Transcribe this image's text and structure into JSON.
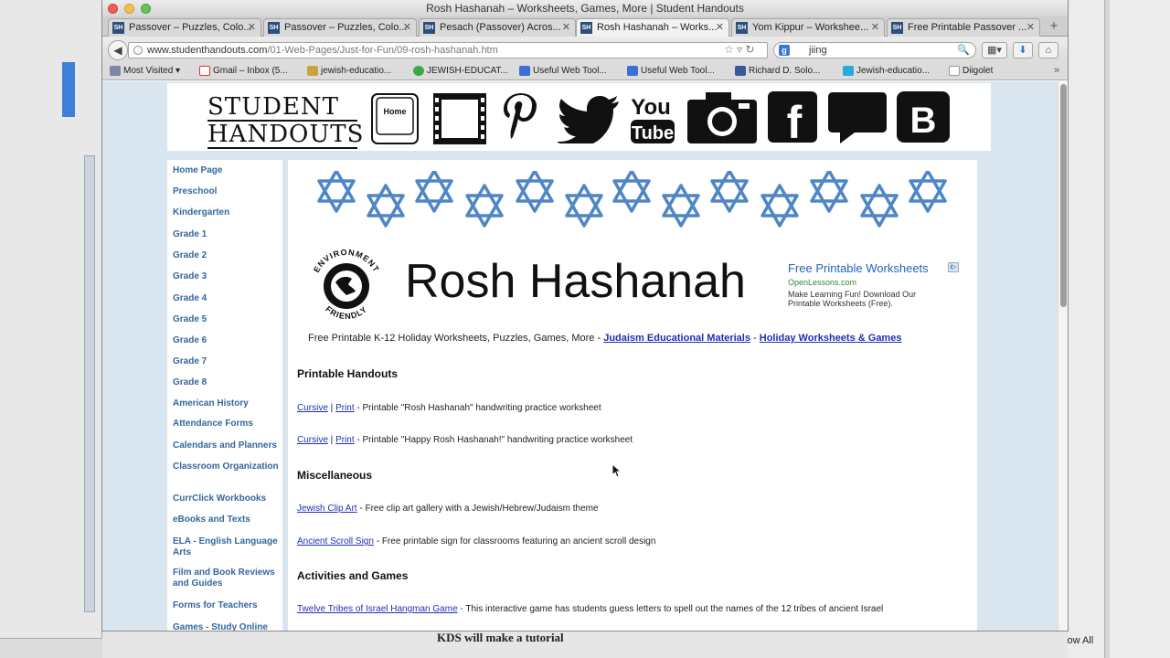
{
  "window": {
    "title": "Rosh Hashanah – Worksheets, Games, More | Student Handouts"
  },
  "tabs": [
    {
      "label": "Passover – Puzzles, Colo..."
    },
    {
      "label": "Passover – Puzzles, Colo..."
    },
    {
      "label": "Pesach (Passover) Acros..."
    },
    {
      "label": "Rosh Hashanah – Works..."
    },
    {
      "label": "Yom Kippur – Workshee..."
    },
    {
      "label": "Free Printable Passover ..."
    }
  ],
  "favicon_text": "SH",
  "url": {
    "host": "www.studenthandouts.com",
    "path": "/01-Web-Pages/Just-for-Fun/09-rosh-hashanah.htm"
  },
  "search": {
    "value": "jiing"
  },
  "bookmarks": [
    {
      "label": "Most Visited ▾",
      "color": "#7b86a8"
    },
    {
      "label": "Gmail – Inbox (5...",
      "color": "#d33"
    },
    {
      "label": "jewish-educatio...",
      "color": "#c8a440"
    },
    {
      "label": "JEWISH-EDUCAT...",
      "color": "#3aa845"
    },
    {
      "label": "Useful Web Tool...",
      "color": "#3c6ed6"
    },
    {
      "label": "Useful Web Tool...",
      "color": "#3c6ed6"
    },
    {
      "label": "Richard D. Solo...",
      "color": "#3b5998"
    },
    {
      "label": "Jewish-educatio...",
      "color": "#2aa9e0"
    },
    {
      "label": "Diigolet",
      "color": "#ccc"
    }
  ],
  "header": {
    "logo_line1": "STUDENT",
    "logo_line2": "HANDOUTS",
    "home_key": "Home",
    "youtube_top": "You",
    "youtube_bottom": "Tube",
    "facebook": "f",
    "blogger": "B"
  },
  "sidenav": {
    "items": [
      "Home Page",
      "Preschool",
      "Kindergarten",
      "Grade 1",
      "Grade 2",
      "Grade 3",
      "Grade 4",
      "Grade 5",
      "Grade 6",
      "Grade 7",
      "Grade 8",
      "American History",
      "Attendance Forms",
      "Calendars and Planners",
      "Classroom Organization",
      "CurrClick Workbooks",
      "eBooks and Texts",
      "ELA - English Language Arts",
      "Film and Book Reviews and Guides",
      "Forms for Teachers",
      "Games - Study Online"
    ]
  },
  "main": {
    "title": "Rosh Hashanah",
    "env_logo_top": "ENVIRONMENT",
    "env_logo_bottom": "FRIENDLY",
    "ad": {
      "title": "Free Printable Worksheets",
      "url": "OpenLessons.com",
      "text": "Make Learning Fun! Download Our Printable Worksheets (Free).",
      "badge": "i▷"
    },
    "tagline": {
      "text": "Free Printable K-12 Holiday Worksheets, Puzzles, Games, More - ",
      "link1": "Judaism Educational Materials",
      "sep": " - ",
      "link2": "Holiday Worksheets & Games"
    },
    "sections": {
      "printable": "Printable Handouts",
      "misc": "Miscellaneous",
      "activities": "Activities and Games"
    },
    "entries": {
      "e1": {
        "link_a": "Cursive",
        "sep": " | ",
        "link_b": "Print",
        "text": " - Printable \"Rosh Hashanah\" handwriting practice worksheet"
      },
      "e2": {
        "link_a": "Cursive",
        "sep": " | ",
        "link_b": "Print",
        "text": " - Printable \"Happy Rosh Hashanah!\" handwriting practice worksheet"
      },
      "e3": {
        "link": "Jewish Clip Art",
        "text": " - Free clip art gallery with a Jewish/Hebrew/Judaism theme"
      },
      "e4": {
        "link": "Ancient Scroll Sign",
        "text": " - Free printable sign for classrooms featuring an ancient scroll design"
      },
      "e5": {
        "link": "Twelve Tribes of Israel Hangman Game",
        "text": " - This interactive game has students guess letters to spell out the names of the 12 tribes of ancient Israel"
      }
    }
  },
  "background": {
    "show_all": "Show All",
    "doc_text": "KDS will make a tutorial"
  },
  "colors": {
    "nav_link": "#34679e",
    "link": "#1f2fb4",
    "star": "#4f86c6",
    "page_bg": "#d9e6f0"
  }
}
